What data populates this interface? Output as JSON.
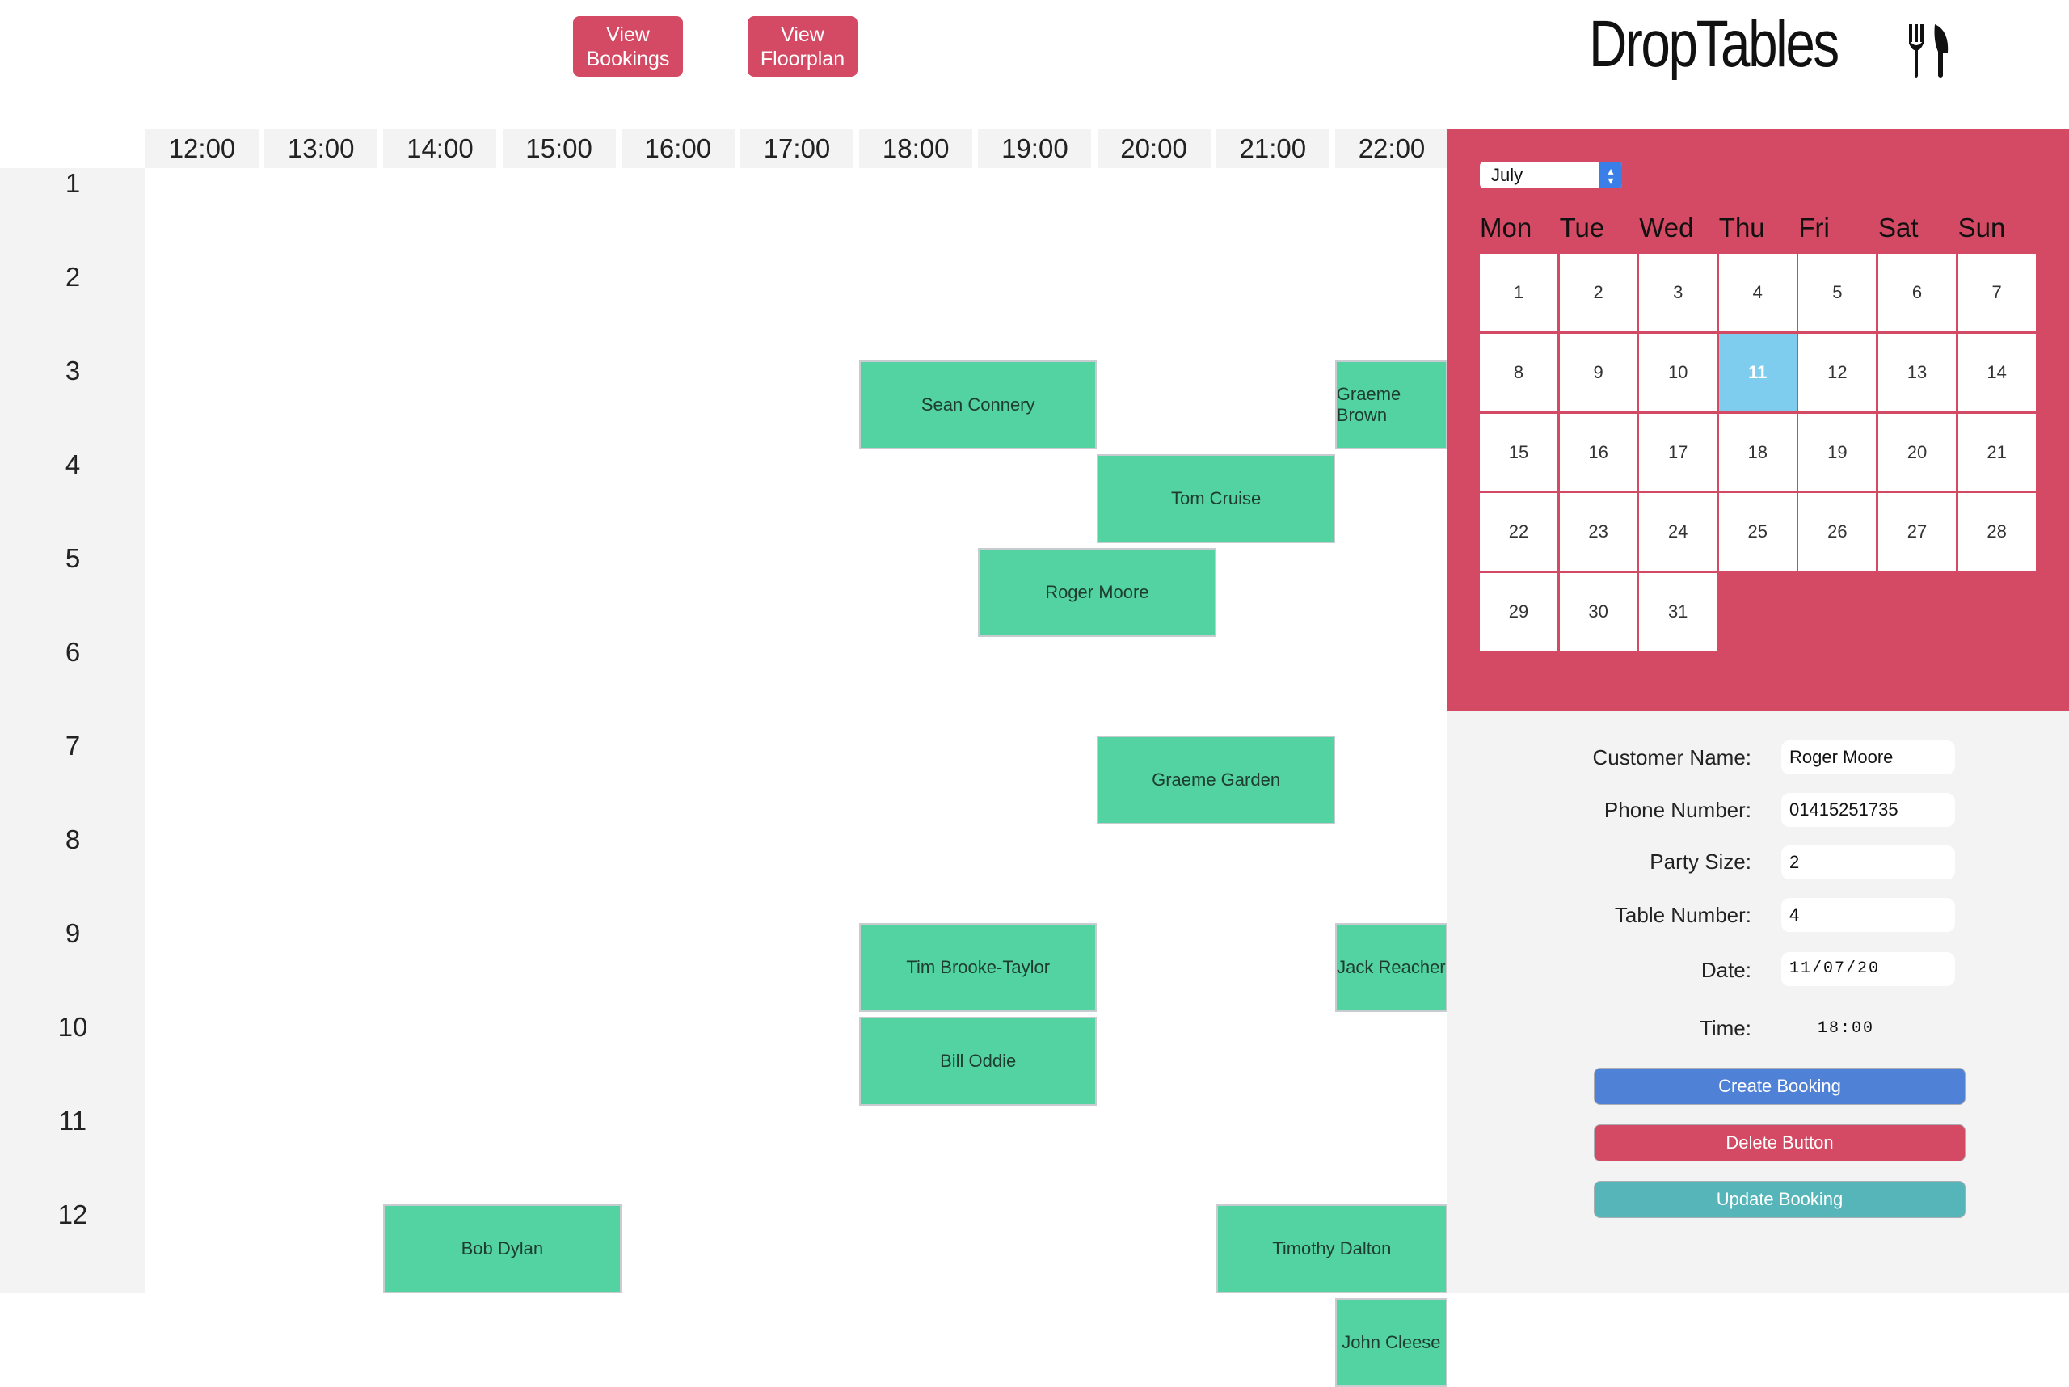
{
  "nav": {
    "view_bookings": "View\nBookings",
    "view_floorplan": "View\nFloorplan"
  },
  "logo": {
    "text": "DropTables",
    "icon": "fork-knife-icon"
  },
  "schedule": {
    "times": [
      "12:00",
      "13:00",
      "14:00",
      "15:00",
      "16:00",
      "17:00",
      "18:00",
      "19:00",
      "20:00",
      "21:00",
      "22:00"
    ],
    "tables": [
      "1",
      "2",
      "3",
      "4",
      "5",
      "6",
      "7",
      "8",
      "9",
      "10",
      "11",
      "12"
    ],
    "bookings": [
      {
        "name": "Sean Connery",
        "table": "2",
        "start": "17:00",
        "end": "19:00"
      },
      {
        "name": "Graeme Brown",
        "table": "2",
        "start": "21:00",
        "end": "23:00"
      },
      {
        "name": "Tom Cruise",
        "table": "3",
        "start": "19:00",
        "end": "21:00"
      },
      {
        "name": "Roger Moore",
        "table": "4",
        "start": "18:00",
        "end": "20:00"
      },
      {
        "name": "Graeme Garden",
        "table": "6",
        "start": "19:00",
        "end": "21:00"
      },
      {
        "name": "Tim Brooke-Taylor",
        "table": "8",
        "start": "17:00",
        "end": "19:00"
      },
      {
        "name": "Jack Reacher",
        "table": "8",
        "start": "21:00",
        "end": "23:00"
      },
      {
        "name": "Bill Oddie",
        "table": "9",
        "start": "17:00",
        "end": "19:00"
      },
      {
        "name": "Bob Dylan",
        "table": "11",
        "start": "13:00",
        "end": "15:00"
      },
      {
        "name": "Timothy Dalton",
        "table": "11",
        "start": "20:00",
        "end": "22:00"
      },
      {
        "name": "John Cleese",
        "table": "12",
        "start": "21:00",
        "end": "23:00"
      }
    ]
  },
  "calendar": {
    "month": "July",
    "weekdays": [
      "Mon",
      "Tue",
      "Wed",
      "Thu",
      "Fri",
      "Sat",
      "Sun"
    ],
    "days": [
      "1",
      "2",
      "3",
      "4",
      "5",
      "6",
      "7",
      "8",
      "9",
      "10",
      "11",
      "12",
      "13",
      "14",
      "15",
      "16",
      "17",
      "18",
      "19",
      "20",
      "21",
      "22",
      "23",
      "24",
      "25",
      "26",
      "27",
      "28",
      "29",
      "30",
      "31"
    ],
    "selected_day": "11"
  },
  "form": {
    "customer_name_label": "Customer Name:",
    "customer_name": "Roger Moore",
    "phone_label": "Phone Number:",
    "phone": "01415251735",
    "party_size_label": "Party Size:",
    "party_size": "2",
    "table_number_label": "Table Number:",
    "table_number": "4",
    "date_label": "Date:",
    "date": "11/07/20",
    "time_label": "Time:",
    "time": "18:00"
  },
  "actions": {
    "create": "Create Booking",
    "delete": "Delete Button",
    "update": "Update Booking"
  },
  "colors": {
    "accent": "#d44a64",
    "booking": "#52d3a1",
    "selected_day": "#7fcdee",
    "create": "#4f82d6",
    "delete": "#d44a64",
    "update": "#55b5b8"
  }
}
